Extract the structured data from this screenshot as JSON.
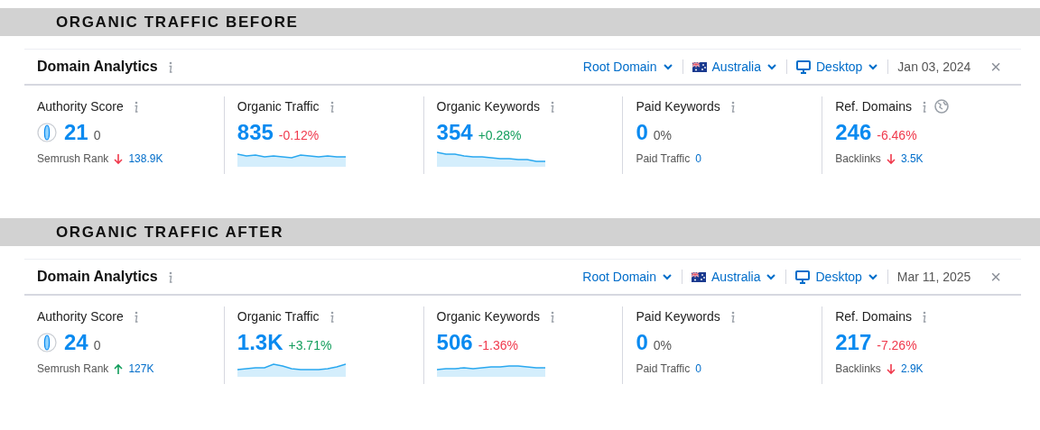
{
  "sections": [
    {
      "banner": "ORGANIC TRAFFIC BEFORE",
      "widget": {
        "title": "Domain Analytics",
        "filters": [
          {
            "kind": "scope",
            "label": "Root Domain"
          },
          {
            "kind": "country",
            "label": "Australia"
          },
          {
            "kind": "device",
            "label": "Desktop"
          }
        ],
        "date": "Jan 03, 2024",
        "close": "×",
        "metrics": [
          {
            "kind": "score",
            "label": "Authority Score",
            "value": "21",
            "change": "0",
            "color": "#555555",
            "sub": {
              "label": "Semrush Rank",
              "arrow_up": false,
              "value": "138.9K"
            }
          },
          {
            "kind": "sparkline",
            "label": "Organic Traffic",
            "value": "835",
            "change": "-0.12%",
            "color": "#f03a4d"
          },
          {
            "kind": "sparkline",
            "label": "Organic Keywords",
            "value": "354",
            "change": "+0.28%",
            "color": "#119d5b"
          },
          {
            "kind": "plain",
            "label": "Paid Keywords",
            "value": "0",
            "change": "0%",
            "color": "#555555",
            "sub": {
              "label": "Paid Traffic",
              "value": "0"
            }
          },
          {
            "kind": "plain",
            "label": "Ref. Domains",
            "value": "246",
            "change": "-6.46%",
            "color": "#f03a4d",
            "globe": true,
            "sub": {
              "label": "Backlinks",
              "arrow_up": false,
              "value": "3.5K"
            }
          }
        ]
      }
    },
    {
      "banner": "ORGANIC TRAFFIC AFTER",
      "widget": {
        "title": "Domain Analytics",
        "filters": [
          {
            "kind": "scope",
            "label": "Root Domain"
          },
          {
            "kind": "country",
            "label": "Australia"
          },
          {
            "kind": "device",
            "label": "Desktop"
          }
        ],
        "date": "Mar 11, 2025",
        "close": "×",
        "metrics": [
          {
            "kind": "score",
            "label": "Authority Score",
            "value": "24",
            "change": "0",
            "color": "#555555",
            "sub": {
              "label": "Semrush Rank",
              "arrow_up": true,
              "value": "127K"
            }
          },
          {
            "kind": "sparkline",
            "label": "Organic Traffic",
            "value": "1.3K",
            "change": "+3.71%",
            "color": "#119d5b"
          },
          {
            "kind": "sparkline",
            "label": "Organic Keywords",
            "value": "506",
            "change": "-1.36%",
            "color": "#f03a4d"
          },
          {
            "kind": "plain",
            "label": "Paid Keywords",
            "value": "0",
            "change": "0%",
            "color": "#555555",
            "sub": {
              "label": "Paid Traffic",
              "value": "0"
            }
          },
          {
            "kind": "plain",
            "label": "Ref. Domains",
            "value": "217",
            "change": "-7.26%",
            "color": "#f03a4d",
            "sub": {
              "label": "Backlinks",
              "arrow_up": false,
              "value": "2.9K"
            }
          }
        ]
      }
    }
  ]
}
